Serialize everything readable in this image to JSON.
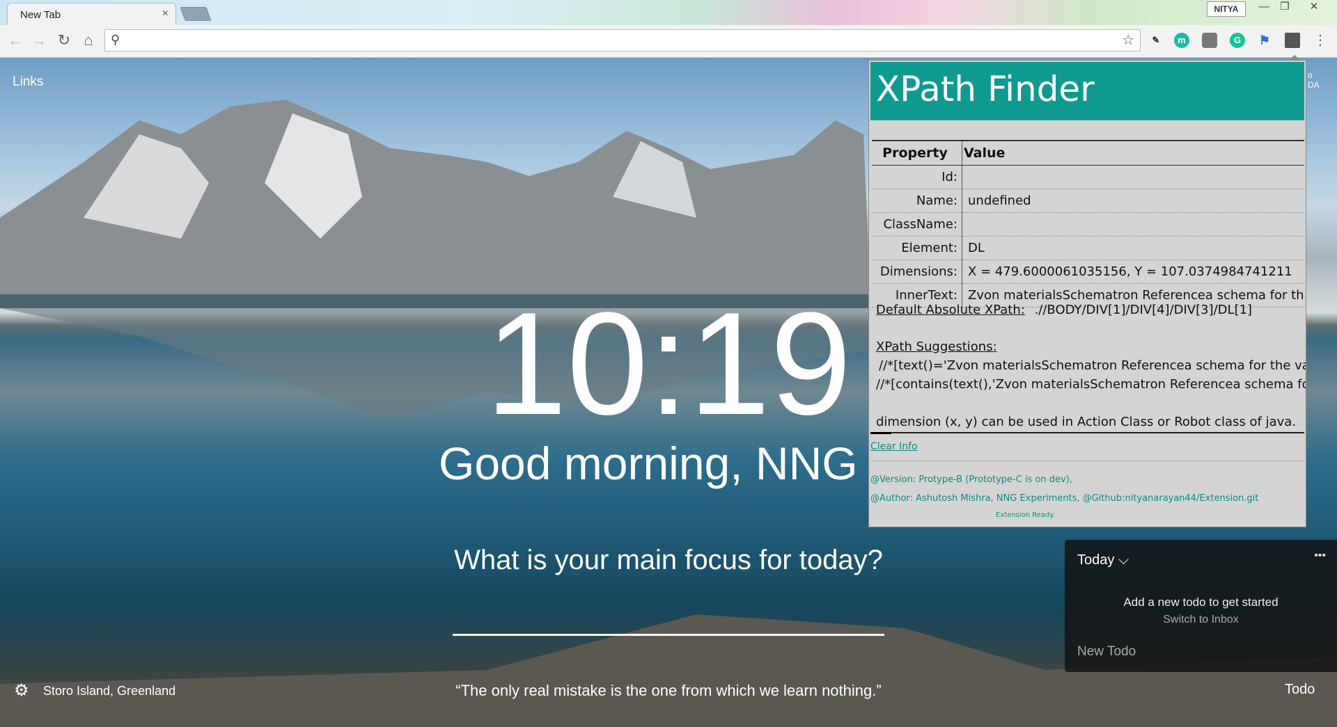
{
  "browser": {
    "tab_title": "New Tab",
    "tab_close": "×",
    "profile": "NITYA",
    "omnibox_placeholder": ""
  },
  "newtab": {
    "links": "Links",
    "clock": "10:19",
    "greeting": "Good morning, NNG",
    "focus_question": "What is your main focus for today?",
    "location": "Storo Island, Greenland",
    "quote": "“The only real mistake is the one from which we learn nothing.”",
    "todo_link": "Todo",
    "todo_panel": {
      "header": "Today ⌵",
      "more": "•••",
      "empty": "Add a new todo to get started",
      "switch": "Switch to Inbox",
      "new_todo": "New Todo"
    },
    "right_fragment_1": "o",
    "right_fragment_2": "DA"
  },
  "xpath_finder": {
    "title": "XPath Finder",
    "table_headers": {
      "property": "Property",
      "value": "Value"
    },
    "rows": [
      {
        "key": "Id:",
        "value": ""
      },
      {
        "key": "Name:",
        "value": "undefined"
      },
      {
        "key": "ClassName:",
        "value": ""
      },
      {
        "key": "Element:",
        "value": "DL"
      },
      {
        "key": "Dimensions:",
        "value": "X = 479.6000061035156, Y = 107.0374984741211"
      },
      {
        "key": "InnerText:",
        "value": "Zvon materialsSchematron Referencea schema for the v"
      }
    ],
    "abs_label": "Default Absolute XPath:",
    "abs_value": ".//BODY/DIV[1]/DIV[4]/DIV[3]/DL[1]",
    "suggestions_header": "XPath Suggestions:",
    "suggestion_1": "//*[text()='Zvon materialsSchematron Referencea schema for the valic",
    "suggestion_2": "//*[contains(text(),'Zvon materialsSchematron Referencea schema for t",
    "note": "dimension (x, y) can be used in Action Class or Robot class of java.",
    "clear": "Clear Info",
    "version": "@Version: Protype-B (Prototype-C is on dev),",
    "author": "@Author: Ashutosh Mishra,   NNG Experiments, @Github:nityanarayan44/Extension.git",
    "status": "Extension Ready."
  },
  "colors": {
    "accent_teal": "#0e9a8e"
  }
}
